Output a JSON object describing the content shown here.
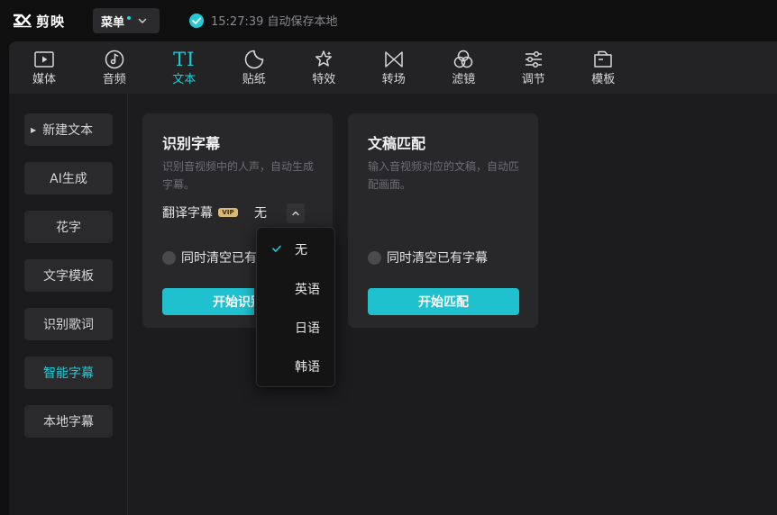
{
  "app": {
    "name": "剪映",
    "menu_label": "菜单",
    "save_status": "15:27:39 自动保存本地"
  },
  "toolbar": {
    "items": [
      {
        "label": "媒体",
        "icon": "media-icon"
      },
      {
        "label": "音频",
        "icon": "audio-icon"
      },
      {
        "label": "文本",
        "icon": "text-icon",
        "glyph": "TI",
        "active": true
      },
      {
        "label": "贴纸",
        "icon": "sticker-icon"
      },
      {
        "label": "特效",
        "icon": "effects-icon"
      },
      {
        "label": "转场",
        "icon": "transition-icon"
      },
      {
        "label": "滤镜",
        "icon": "filter-icon"
      },
      {
        "label": "调节",
        "icon": "adjust-icon"
      },
      {
        "label": "模板",
        "icon": "template-icon"
      }
    ]
  },
  "sidebar": {
    "items": [
      {
        "label": "新建文本"
      },
      {
        "label": "AI生成"
      },
      {
        "label": "花字"
      },
      {
        "label": "文字模板"
      },
      {
        "label": "识别歌词"
      },
      {
        "label": "智能字幕",
        "active": true
      },
      {
        "label": "本地字幕"
      }
    ]
  },
  "cards": {
    "recognize": {
      "title": "识别字幕",
      "description": "识别音视频中的人声，自动生成字幕。",
      "translate_label": "翻译字幕",
      "vip_badge": "VIP",
      "translate_value": "无",
      "clear_label": "同时清空已有字幕",
      "button": "开始识别"
    },
    "match": {
      "title": "文稿匹配",
      "description": "输入音视频对应的文稿，自动匹配画面。",
      "clear_label": "同时清空已有字幕",
      "button": "开始匹配"
    }
  },
  "dropdown": {
    "selected": "无",
    "options": [
      "无",
      "英语",
      "日语",
      "韩语"
    ]
  },
  "colors": {
    "accent": "#22cbd6",
    "button": "#1fc1cf",
    "vip": "#d9b877"
  }
}
